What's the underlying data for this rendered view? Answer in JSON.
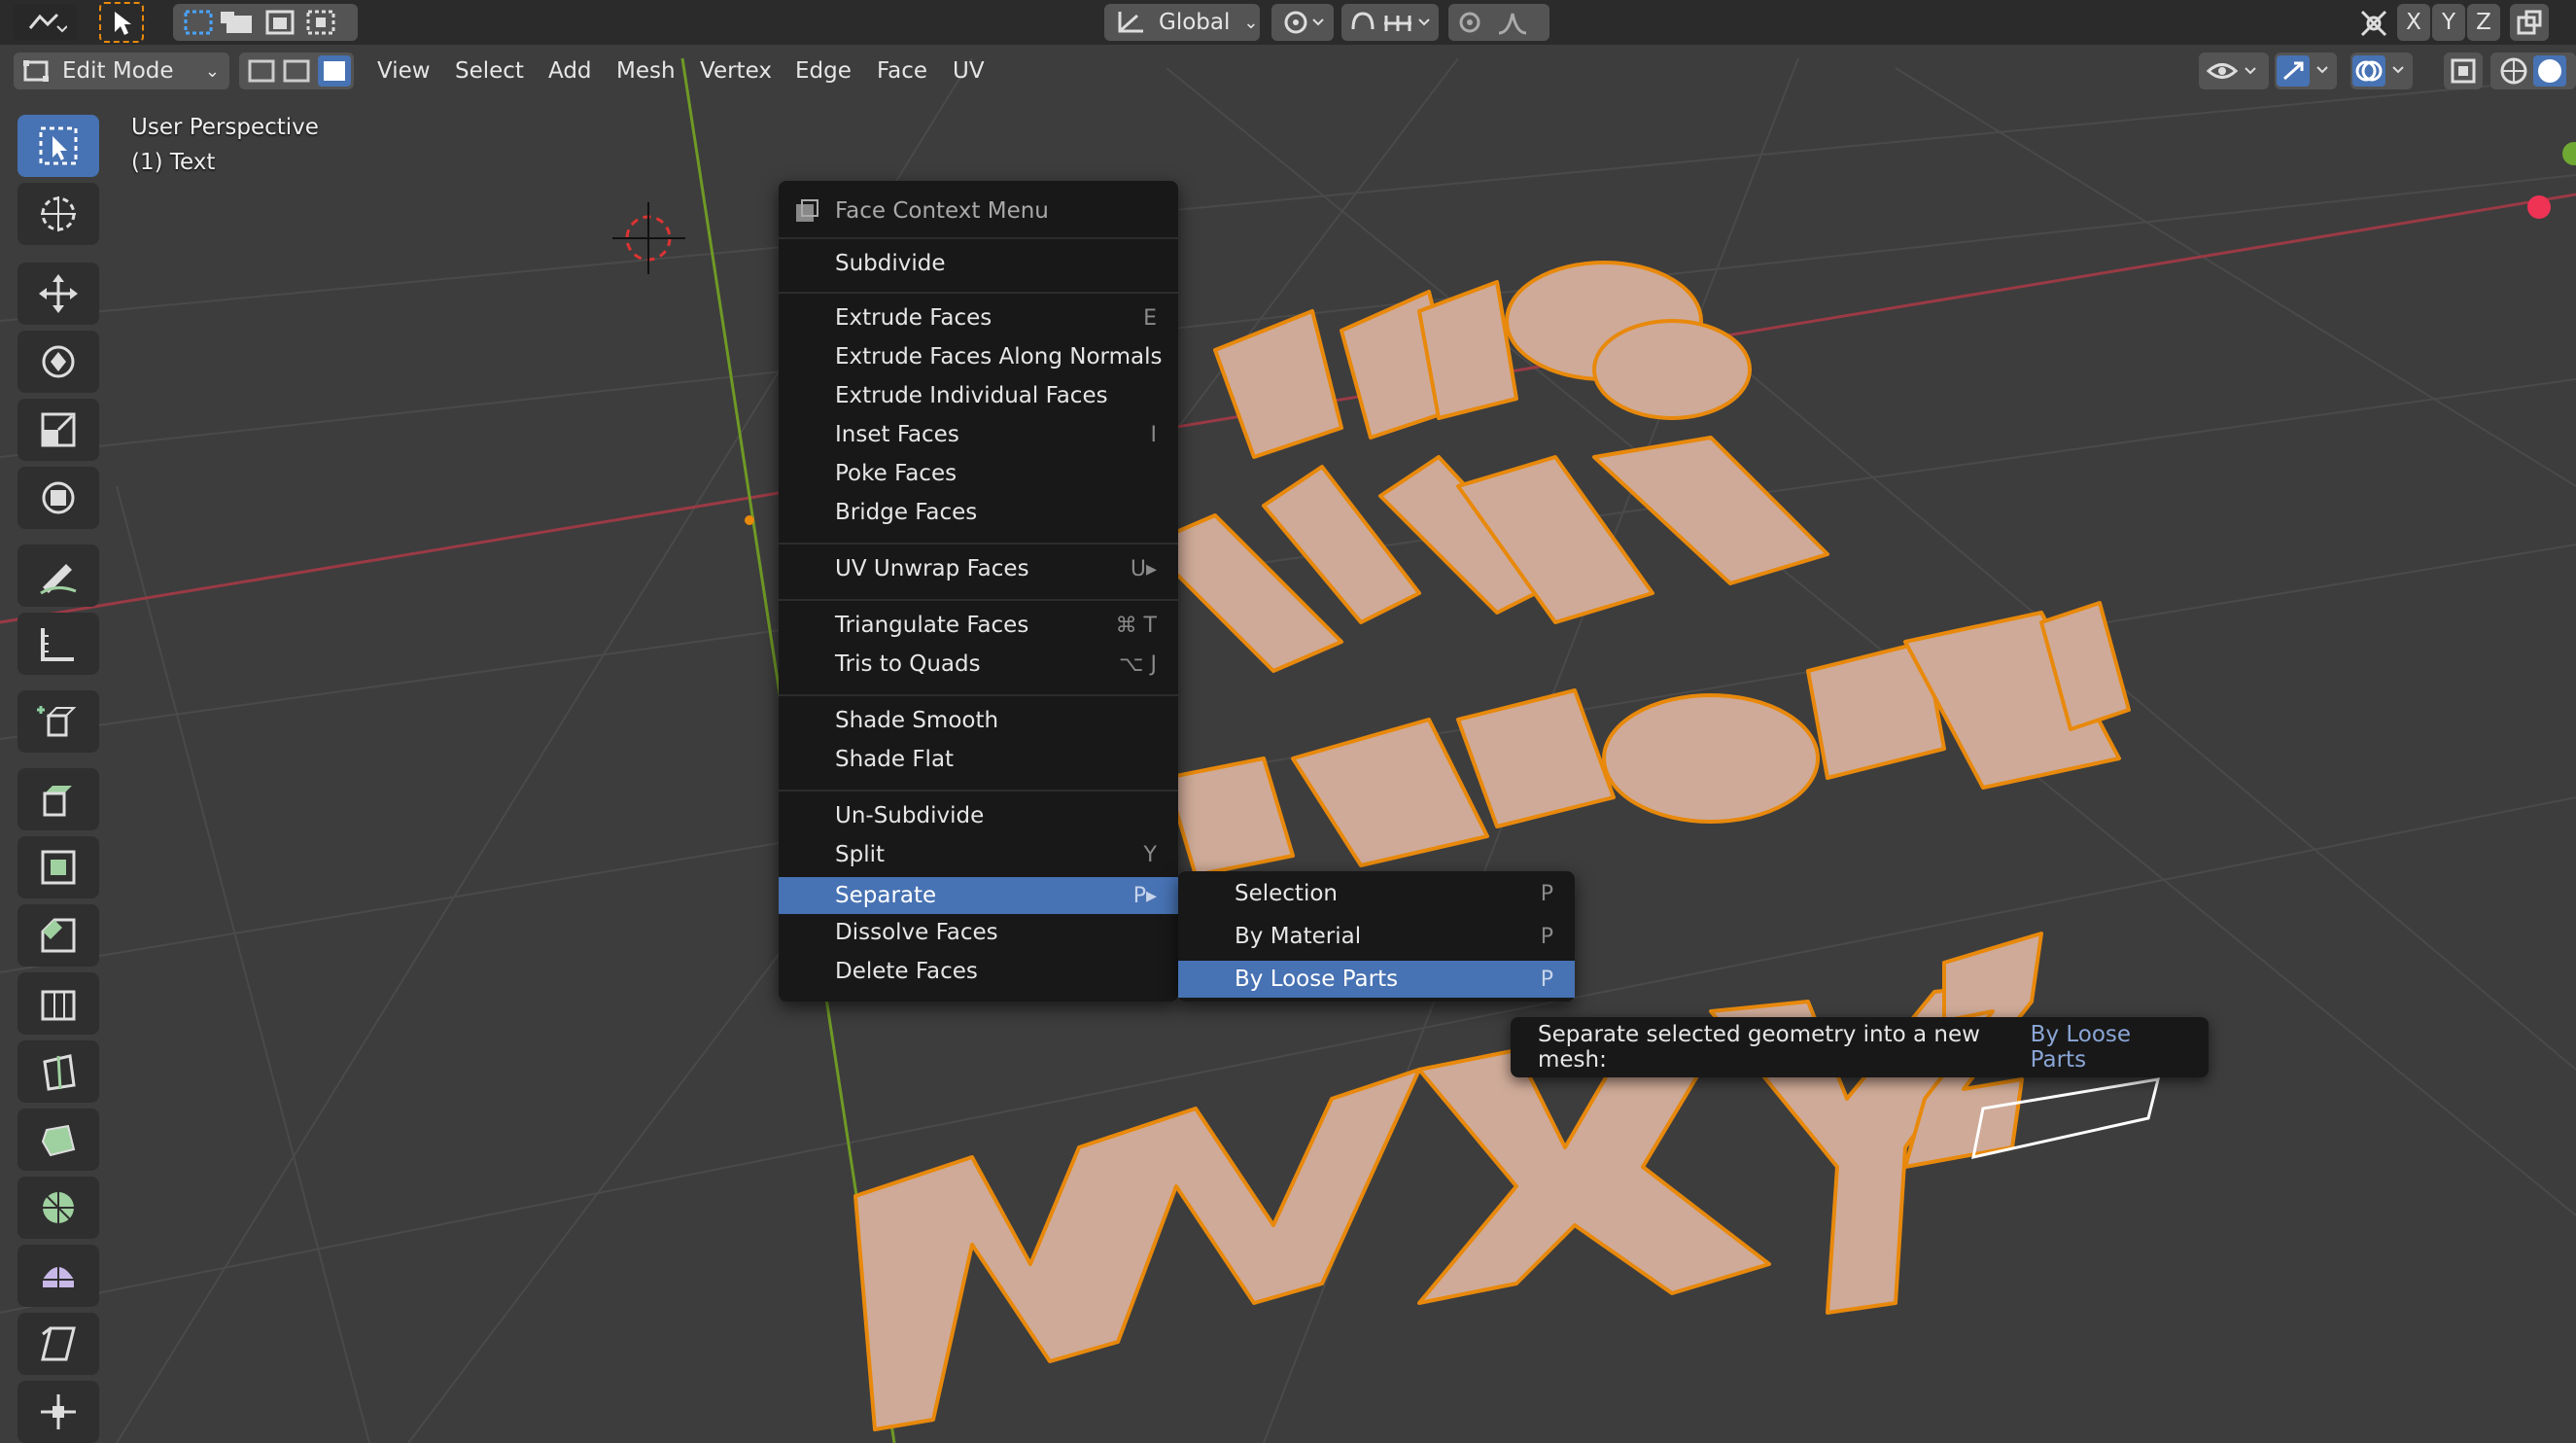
{
  "topbar": {
    "orientation": "Global",
    "axes": [
      "X",
      "Y",
      "Z"
    ]
  },
  "header": {
    "mode": "Edit Mode",
    "menus": [
      "View",
      "Select",
      "Add",
      "Mesh",
      "Vertex",
      "Edge",
      "Face",
      "UV"
    ]
  },
  "viewport": {
    "perspective": "User Perspective",
    "object": "(1) Text"
  },
  "context_menu": {
    "title": "Face Context Menu",
    "items": [
      {
        "label": "Subdivide",
        "shortcut": ""
      },
      {
        "label": "Extrude Faces",
        "shortcut": "E"
      },
      {
        "label": "Extrude Faces Along Normals",
        "shortcut": ""
      },
      {
        "label": "Extrude Individual Faces",
        "shortcut": ""
      },
      {
        "label": "Inset Faces",
        "shortcut": "I"
      },
      {
        "label": "Poke Faces",
        "shortcut": ""
      },
      {
        "label": "Bridge Faces",
        "shortcut": ""
      },
      {
        "label": "UV Unwrap Faces",
        "shortcut": "U▸"
      },
      {
        "label": "Triangulate Faces",
        "shortcut": "⌘ T"
      },
      {
        "label": "Tris to Quads",
        "shortcut": "⌥ J"
      },
      {
        "label": "Shade Smooth",
        "shortcut": ""
      },
      {
        "label": "Shade Flat",
        "shortcut": ""
      },
      {
        "label": "Un-Subdivide",
        "shortcut": ""
      },
      {
        "label": "Split",
        "shortcut": "Y"
      },
      {
        "label": "Separate",
        "shortcut": "P▸"
      },
      {
        "label": "Dissolve Faces",
        "shortcut": ""
      },
      {
        "label": "Delete Faces",
        "shortcut": ""
      }
    ]
  },
  "submenu": {
    "items": [
      {
        "label": "Selection",
        "shortcut": "P"
      },
      {
        "label": "By Material",
        "shortcut": "P"
      },
      {
        "label": "By Loose Parts",
        "shortcut": "P"
      }
    ]
  },
  "tooltip": {
    "text": "Separate selected geometry into a new mesh:",
    "value": "By Loose Parts"
  },
  "colors": {
    "accent": "#4772b3",
    "menu_bg": "#181818",
    "viewport_bg": "#3d3d3d",
    "selection_orange": "#e8890c",
    "mesh_face": "#cfaa98"
  },
  "icons": {
    "editor_type": "editor-type-icon",
    "cursor": "3d-cursor-icon"
  }
}
